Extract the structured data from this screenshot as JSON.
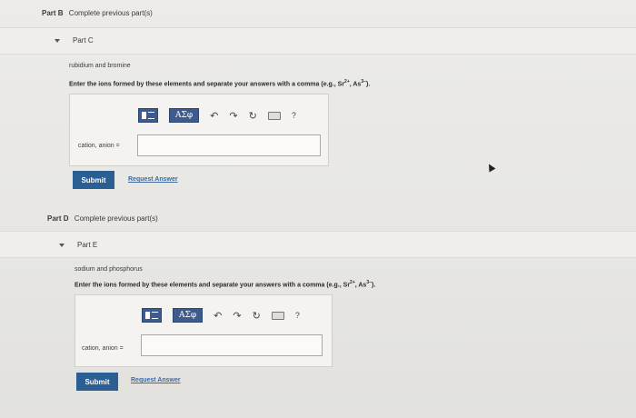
{
  "part_b": {
    "tag": "Part B",
    "text": "Complete previous part(s)"
  },
  "part_c": {
    "title": "Part C",
    "elements": "rubidium and bromine",
    "instruction": "Enter the ions formed by these elements and separate your answers with a comma (e.g., Sr",
    "ex1_sup": "2+",
    "ex_sep": ", As",
    "ex2_sup": "3−",
    "ex_end": ").",
    "toolbar_greek": "ΑΣφ",
    "toolbar_help": "?",
    "input_label": "cation, anion =",
    "input_value": "",
    "submit_label": "Submit",
    "request_label": "Request Answer"
  },
  "part_d": {
    "tag": "Part D",
    "text": "Complete previous part(s)"
  },
  "part_e": {
    "title": "Part E",
    "elements": "sodium and phosphorus",
    "instruction": "Enter the ions formed by these elements and separate your answers with a comma (e.g., Sr",
    "ex1_sup": "2+",
    "ex_sep": ", As",
    "ex2_sup": "3−",
    "ex_end": ").",
    "toolbar_greek": "ΑΣφ",
    "toolbar_help": "?",
    "input_label": "cation, anion =",
    "input_value": "",
    "submit_label": "Submit",
    "request_label": "Request Answer"
  },
  "icons": {
    "templates": "templates-icon",
    "undo": "undo-icon",
    "redo": "redo-icon",
    "reset": "reset-icon",
    "keyboard": "keyboard-icon",
    "help": "help-icon",
    "caret": "caret-down-icon"
  },
  "colors": {
    "accent": "#2b5e92",
    "toolbar": "#3d5b8c",
    "link": "#3c6aa0"
  }
}
